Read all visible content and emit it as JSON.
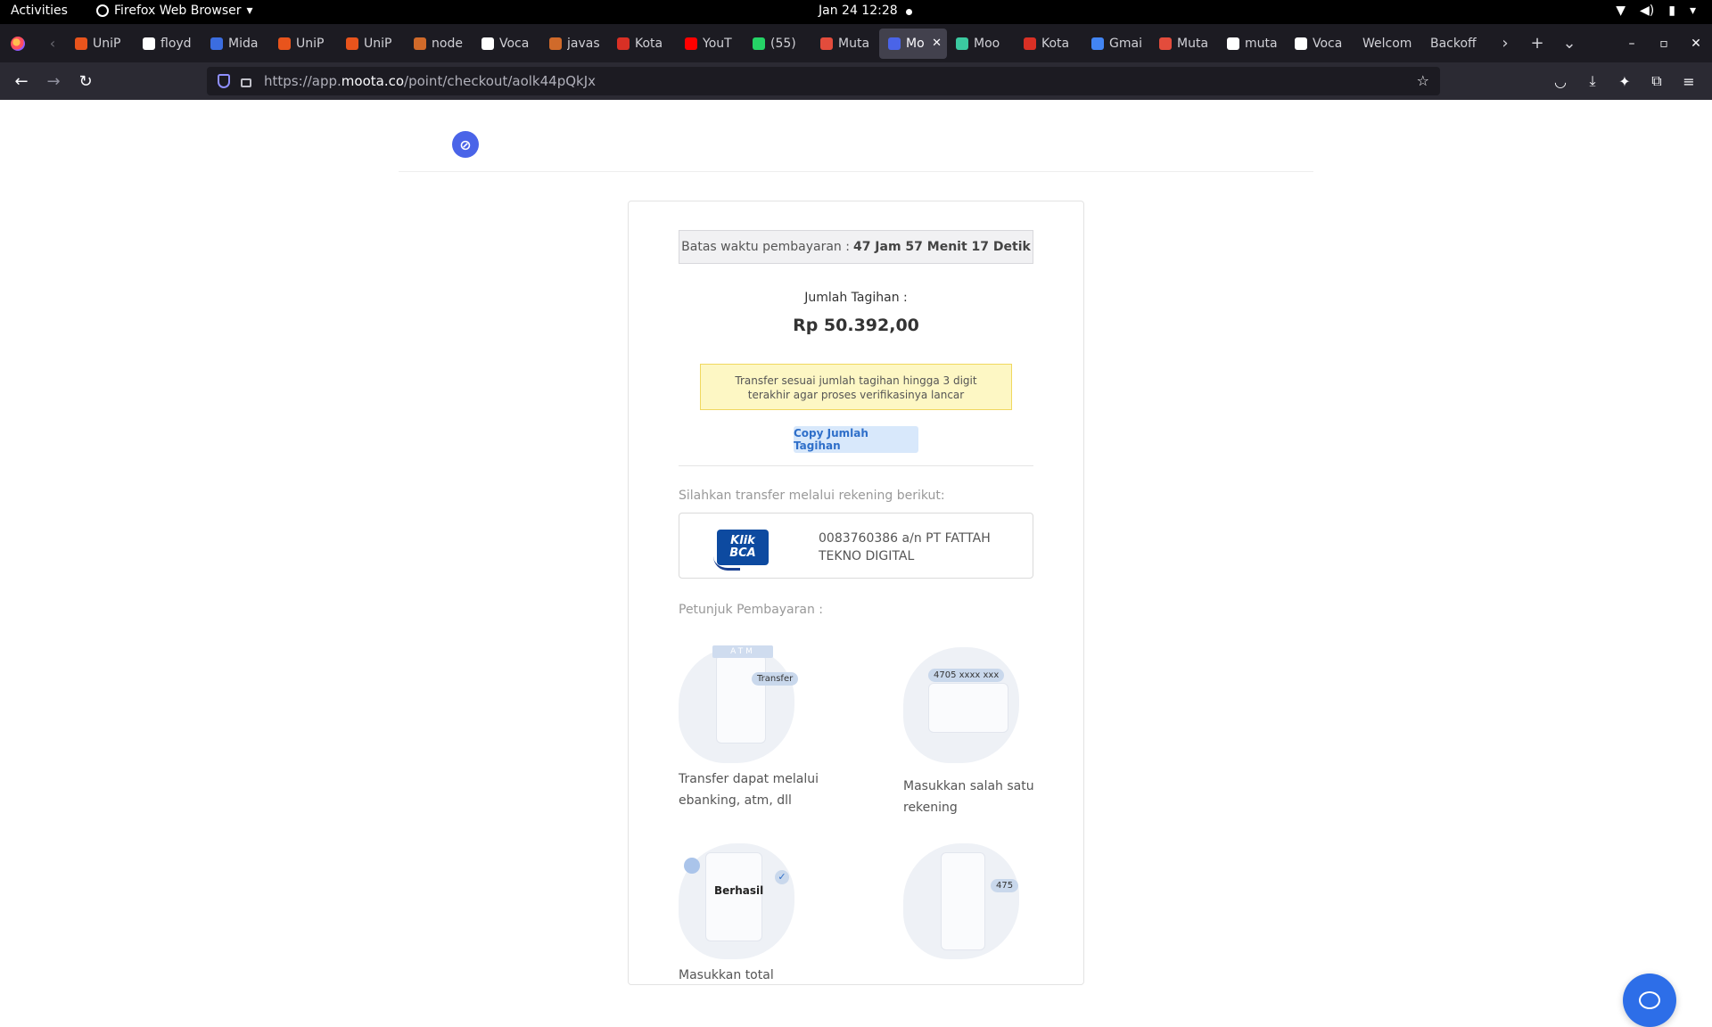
{
  "system_bar": {
    "activities": "Activities",
    "app_name": "Firefox Web Browser",
    "datetime": "Jan 24  12:28"
  },
  "tabs": [
    {
      "title": "UniP",
      "color": "#e8541c"
    },
    {
      "title": "floyd",
      "color": "#ffffff"
    },
    {
      "title": "Mida",
      "color": "#3b6de0"
    },
    {
      "title": "UniP",
      "color": "#e8541c"
    },
    {
      "title": "UniP",
      "color": "#e8541c"
    },
    {
      "title": "node",
      "color": "#d06a2a"
    },
    {
      "title": "Voca",
      "color": "#ffffff"
    },
    {
      "title": "javas",
      "color": "#d06a2a"
    },
    {
      "title": "Kota",
      "color": "#d93025"
    },
    {
      "title": "YouT",
      "color": "#ff0000"
    },
    {
      "title": "(55) ",
      "color": "#25d366"
    },
    {
      "title": "Muta",
      "color": "#e34c3c"
    },
    {
      "title": "Mo",
      "color": "#4a64e8",
      "active": true
    },
    {
      "title": "Moo",
      "color": "#3bc9a0"
    },
    {
      "title": "Kota",
      "color": "#d93025"
    },
    {
      "title": "Gmai",
      "color": "#4285f4"
    },
    {
      "title": "Muta",
      "color": "#e34c3c"
    },
    {
      "title": "muta",
      "color": "#ffffff"
    },
    {
      "title": "Voca",
      "color": "#ffffff"
    },
    {
      "title": "Welcom",
      "color": ""
    },
    {
      "title": "Backoff",
      "color": ""
    }
  ],
  "urlbar": {
    "url_prefix": "https://app.",
    "url_domain": "moota.co",
    "url_path": "/point/checkout/aolk44pQkJx"
  },
  "checkout": {
    "deadline_label": "Batas waktu pembayaran :",
    "deadline_value": "47 Jam 57 Menit 17 Detik",
    "amount_label": "Jumlah Tagihan :",
    "amount_value": "Rp 50.392,00",
    "warning": "Transfer sesuai jumlah tagihan hingga 3 digit terakhir agar proses verifikasinya lancar",
    "copy_button": "Copy Jumlah Tagihan",
    "transfer_label": "Silahkan transfer melalui rekening berikut:",
    "bank_logo_line1": "Klik",
    "bank_logo_line2": "BCA",
    "account": "0083760386 a/n PT FATTAH TEKNO DIGITAL",
    "steps_label": "Petunjuk Pembayaran :",
    "steps": [
      {
        "caption": "Transfer dapat melalui ebanking, atm, dll",
        "tag": "Transfer",
        "banner": "ATM"
      },
      {
        "caption": "Masukkan salah satu rekening",
        "tag": "4705 xxxx xxx"
      },
      {
        "caption": "Masukkan total",
        "tag": "Berhasil"
      },
      {
        "caption": "",
        "tag": "475"
      }
    ]
  },
  "colors": {
    "brand": "#4a64e8",
    "chat": "#2d6ee8",
    "warning_bg": "#fdf7c4"
  }
}
